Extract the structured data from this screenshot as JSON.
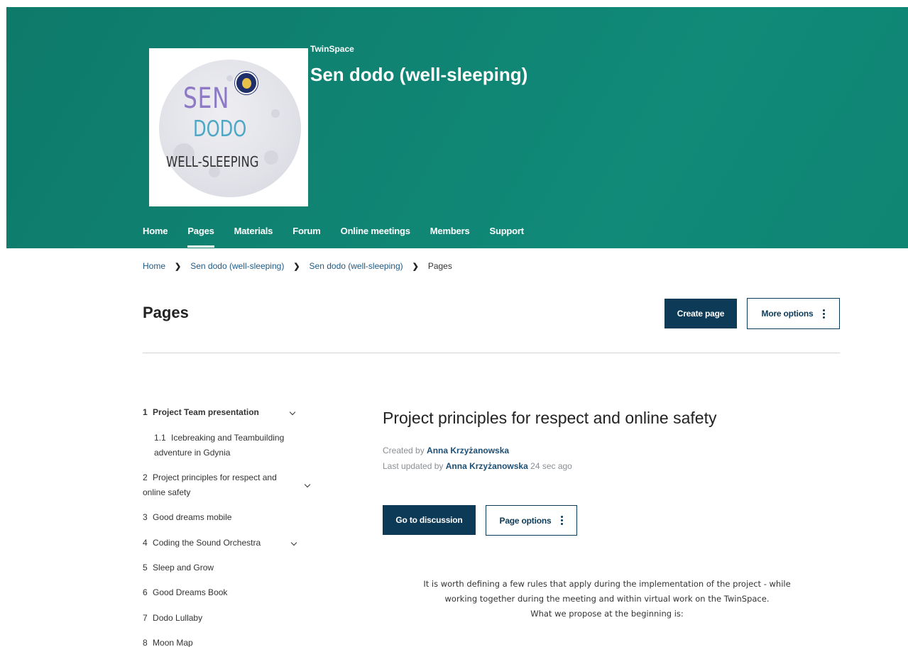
{
  "header": {
    "app_label": "TwinSpace",
    "title": "Sen dodo (well-sleeping)",
    "logo": {
      "line1": "SEN",
      "line2": "DODO",
      "line3": "WELL-SLEEPING"
    }
  },
  "nav": {
    "items": [
      "Home",
      "Pages",
      "Materials",
      "Forum",
      "Online meetings",
      "Members",
      "Support"
    ],
    "active": "Pages"
  },
  "breadcrumb": [
    "Home",
    "Sen dodo (well-sleeping)",
    "Sen dodo (well-sleeping)",
    "Pages"
  ],
  "page": {
    "title": "Pages",
    "create_label": "Create page",
    "more_options_label": "More options"
  },
  "tree": [
    {
      "num": "1",
      "label": "Project Team presentation",
      "bold": true,
      "expandable": true
    },
    {
      "num": "1.1",
      "label": "Icebreaking and Teambuilding adventure in Gdynia"
    },
    {
      "num": "2",
      "label": "Project principles for respect and online safety",
      "expandable": true
    },
    {
      "num": "3",
      "label": "Good dreams mobile"
    },
    {
      "num": "4",
      "label": "Coding the Sound Orchestra",
      "expandable": true
    },
    {
      "num": "5",
      "label": "Sleep and Grow"
    },
    {
      "num": "6",
      "label": "Good Dreams Book"
    },
    {
      "num": "7",
      "label": "Dodo Lullaby"
    },
    {
      "num": "8",
      "label": "Moon Map"
    }
  ],
  "document": {
    "title": "Project principles for respect and online safety",
    "created_prefix": "Created by",
    "created_by": "Anna Krzyżanowska",
    "updated_prefix": "Last updated by",
    "updated_by": "Anna Krzyżanowska",
    "updated_time": "24 sec ago",
    "discussion_label": "Go to discussion",
    "page_options_label": "Page options",
    "body_lines": [
      "It is worth defining a few rules that apply during the implementation of the project - while",
      "working together during the meeting and within virtual work on the TwinSpace.",
      "What we propose at the beginning is:"
    ]
  },
  "colors": {
    "header_bg": "#0e7a6a",
    "primary_button": "#0d3a56",
    "link": "#1d4f74"
  }
}
